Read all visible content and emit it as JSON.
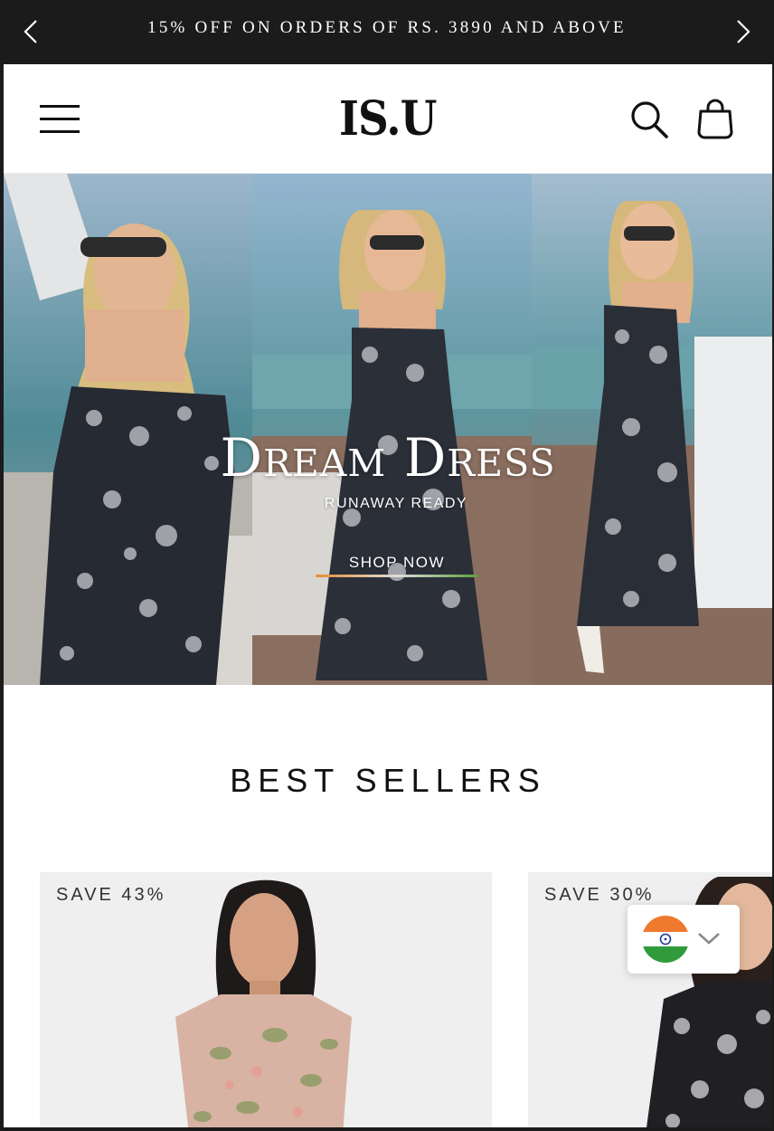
{
  "announcement": {
    "text": "15% OFF ON ORDERS OF RS. 3890 AND ABOVE",
    "prev_icon": "chevron-left-icon",
    "next_icon": "chevron-right-icon"
  },
  "header": {
    "logo": "IS.U",
    "menu_icon": "hamburger-menu-icon",
    "search_icon": "search-icon",
    "cart_icon": "shopping-bag-icon"
  },
  "hero": {
    "title": "Dream Dress",
    "subtitle": "RUNAWAY READY",
    "cta": "SHOP NOW"
  },
  "best_sellers": {
    "title": "BEST SELLERS",
    "products": [
      {
        "badge": "SAVE 43%"
      },
      {
        "badge": "SAVE 30%"
      }
    ]
  },
  "country_selector": {
    "flag_icon": "india-flag-icon",
    "chevron_icon": "chevron-down-icon"
  },
  "colors": {
    "announcement_bg": "#1b1b1b",
    "page_bg": "#ffffff",
    "card_bg": "#efefef",
    "cta_underline_start": "#e98b2f",
    "cta_underline_end": "#5d9f3b"
  }
}
